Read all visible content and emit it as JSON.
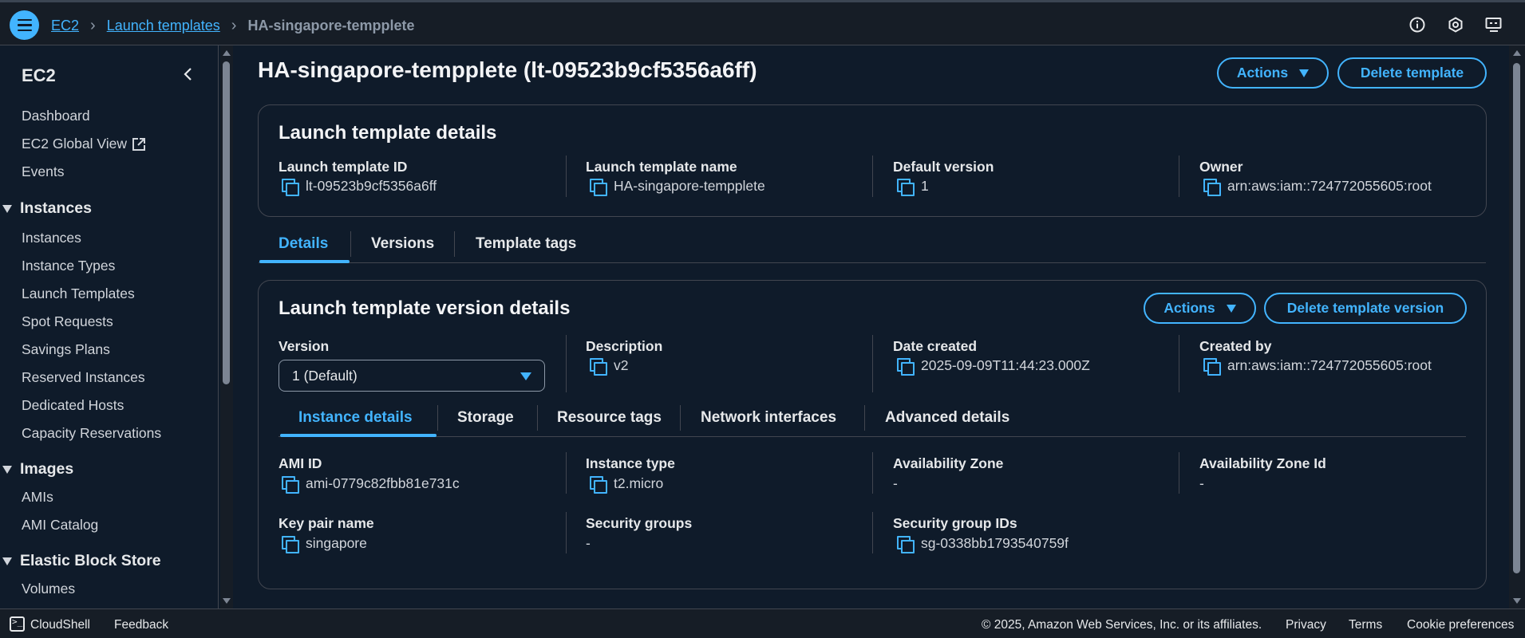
{
  "breadcrumb": {
    "items": [
      "EC2",
      "Launch templates"
    ],
    "current": "HA-singapore-tempplete"
  },
  "sidebar": {
    "title": "EC2",
    "top_items": [
      "Dashboard",
      "EC2 Global View",
      "Events"
    ],
    "sections": [
      {
        "label": "Instances",
        "items": [
          "Instances",
          "Instance Types",
          "Launch Templates",
          "Spot Requests",
          "Savings Plans",
          "Reserved Instances",
          "Dedicated Hosts",
          "Capacity Reservations"
        ]
      },
      {
        "label": "Images",
        "items": [
          "AMIs",
          "AMI Catalog"
        ]
      },
      {
        "label": "Elastic Block Store",
        "items": [
          "Volumes"
        ]
      }
    ]
  },
  "page": {
    "title": "HA-singapore-tempplete (lt-09523b9cf5356a6ff)",
    "actions_label": "Actions",
    "delete_label": "Delete template"
  },
  "template_details": {
    "heading": "Launch template details",
    "fields": [
      {
        "label": "Launch template ID",
        "value": "lt-09523b9cf5356a6ff"
      },
      {
        "label": "Launch template name",
        "value": "HA-singapore-tempplete"
      },
      {
        "label": "Default version",
        "value": "1"
      },
      {
        "label": "Owner",
        "value": "arn:aws:iam::724772055605:root"
      }
    ]
  },
  "tabs": [
    "Details",
    "Versions",
    "Template tags"
  ],
  "version_details": {
    "heading": "Launch template version details",
    "actions_label": "Actions",
    "delete_label": "Delete template version",
    "version_label": "Version",
    "version_value": "1 (Default)",
    "fields": [
      {
        "label": "Description",
        "value": "v2"
      },
      {
        "label": "Date created",
        "value": "2025-09-09T11:44:23.000Z"
      },
      {
        "label": "Created by",
        "value": "arn:aws:iam::724772055605:root"
      }
    ],
    "subtabs": [
      "Instance details",
      "Storage",
      "Resource tags",
      "Network interfaces",
      "Advanced details"
    ],
    "instance_fields": [
      {
        "label": "AMI ID",
        "value": "ami-0779c82fbb81e731c"
      },
      {
        "label": "Instance type",
        "value": "t2.micro"
      },
      {
        "label": "Availability Zone",
        "value": "-"
      },
      {
        "label": "Availability Zone Id",
        "value": "-"
      },
      {
        "label": "Key pair name",
        "value": "singapore"
      },
      {
        "label": "Security groups",
        "value": "-"
      },
      {
        "label": "Security group IDs",
        "value": "sg-0338bb1793540759f"
      }
    ]
  },
  "footer": {
    "cloudshell": "CloudShell",
    "feedback": "Feedback",
    "copyright": "© 2025, Amazon Web Services, Inc. or its affiliates.",
    "privacy": "Privacy",
    "terms": "Terms",
    "cookies": "Cookie preferences"
  },
  "colors": {
    "accent": "#42b4ff",
    "background": "#0f1b2a",
    "bar": "#161d26"
  }
}
